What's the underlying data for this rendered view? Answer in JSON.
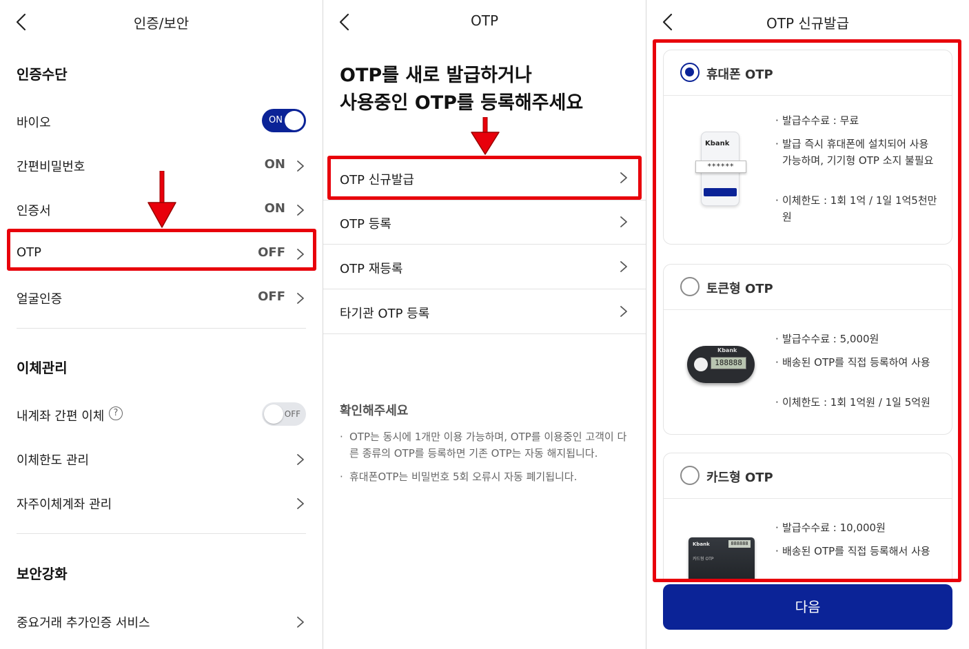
{
  "colors": {
    "brand_blue": "#0b2397",
    "highlight_red": "#e8000b"
  },
  "panel1": {
    "title": "인증/보안",
    "sections": {
      "auth": "인증수단",
      "transfer": "이체관리",
      "security": "보안강화"
    },
    "rows": {
      "bio": {
        "label": "바이오",
        "toggle": "ON"
      },
      "simple_pw": {
        "label": "간편비밀번호",
        "value": "ON"
      },
      "cert": {
        "label": "인증서",
        "value": "ON"
      },
      "otp": {
        "label": "OTP",
        "value": "OFF"
      },
      "face": {
        "label": "얼굴인증",
        "value": "OFF"
      },
      "my_account": {
        "label": "내계좌 간편 이체",
        "toggle": "OFF",
        "help": "?"
      },
      "limit": {
        "label": "이체한도 관리"
      },
      "frequent": {
        "label": "자주이체계좌 관리"
      },
      "extra_auth": {
        "label": "중요거래 추가인증 서비스"
      }
    }
  },
  "panel2": {
    "title": "OTP",
    "headline_line1": "OTP를 새로 발급하거나",
    "headline_line2": "사용중인 OTP를 등록해주세요",
    "menu": [
      "OTP 신규발급",
      "OTP 등록",
      "OTP 재등록",
      "타기관 OTP 등록"
    ],
    "notice_title": "확인해주세요",
    "notice_bullet": "·",
    "notices": [
      "OTP는 동시에 1개만 이용 가능하며, OTP를 이용중인 고객이 다른 종류의 OTP를 등록하면 기존 OTP는 자동 해지됩니다.",
      "휴대폰OTP는 비밀번호 5회 오류시 자동 폐기됩니다."
    ]
  },
  "panel3": {
    "title": "OTP 신규발급",
    "info_bullet": "·",
    "cards": [
      {
        "name": "휴대폰 OTP",
        "selected": true,
        "info": [
          "발급수수료 : 무료",
          "발급 즉시 휴대폰에 설치되어 사용 가능하며, 기기형 OTP 소지 불필요",
          "이체한도 : 1회 1억 / 1일 1억5천만원"
        ],
        "image_text": {
          "brand": "Kbank",
          "code": "******"
        }
      },
      {
        "name": "토큰형 OTP",
        "selected": false,
        "info": [
          "발급수수료 : 5,000원",
          "배송된 OTP를 직접 등록하여 사용",
          "이체한도 : 1회 1억원 / 1일 5억원"
        ],
        "image_text": {
          "brand": "Kbank",
          "code": "188888"
        }
      },
      {
        "name": "카드형 OTP",
        "selected": false,
        "info": [
          "발급수수료 : 10,000원",
          "배송된 OTP를 직접 등록해서 사용"
        ],
        "image_text": {
          "brand": "Kbank",
          "code": "888888",
          "card_label": "카드형 OTP"
        }
      }
    ],
    "next_button": "다음"
  }
}
